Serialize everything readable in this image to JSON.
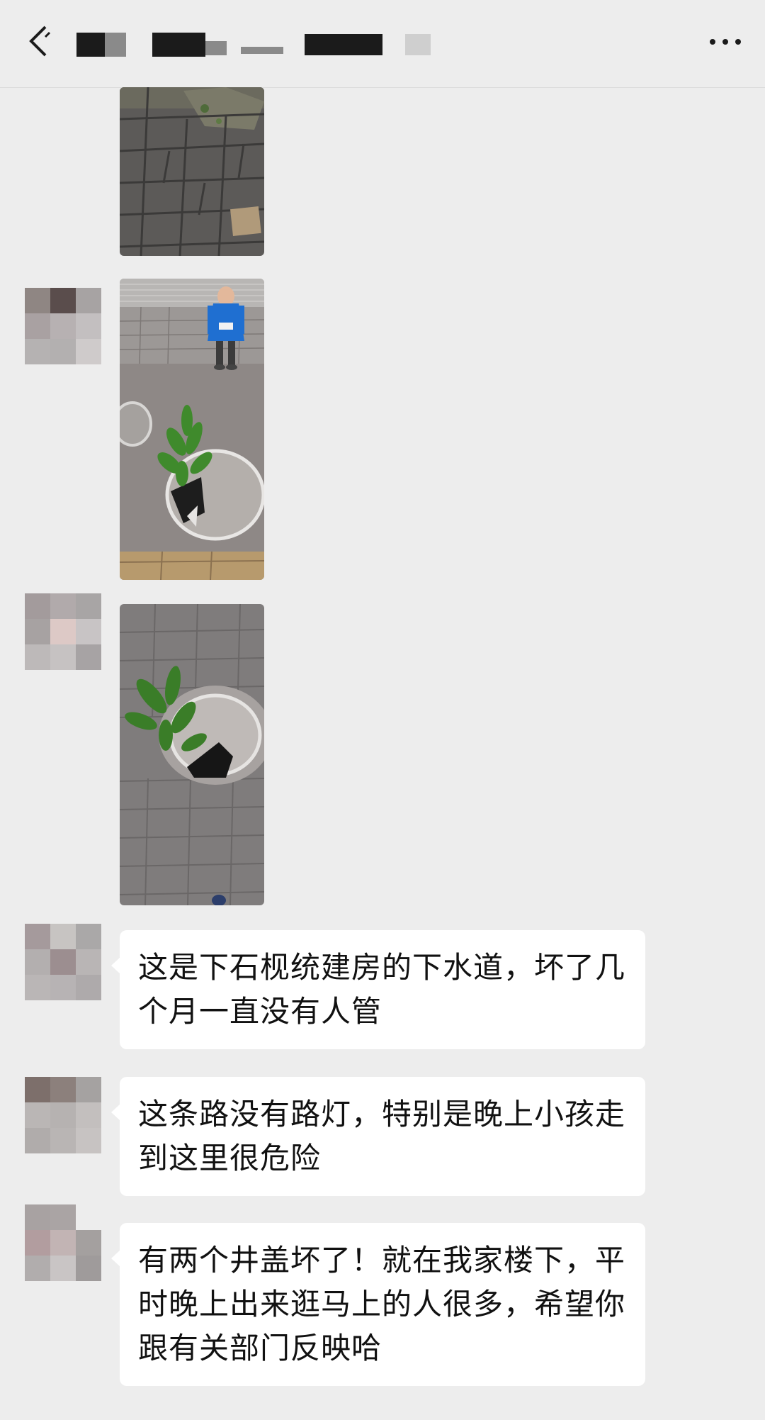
{
  "header": {
    "back_icon": "chevron-left-icon",
    "more_icon": "more-dots-icon"
  },
  "messages": [
    {
      "type": "image",
      "subject": "sidewalk-paving"
    },
    {
      "type": "image",
      "subject": "child-and-manhole"
    },
    {
      "type": "image",
      "subject": "broken-manhole-cover"
    },
    {
      "type": "text",
      "text": "这是下石枧统建房的下水道，坏了几个月一直没有人管"
    },
    {
      "type": "text",
      "text": "这条路没有路灯，特别是晚上小孩走到这里很危险"
    },
    {
      "type": "text",
      "text": "有两个井盖坏了！就在我家楼下，平时晚上出来逛马上的人很多，希望你跟有关部门反映哈"
    }
  ]
}
